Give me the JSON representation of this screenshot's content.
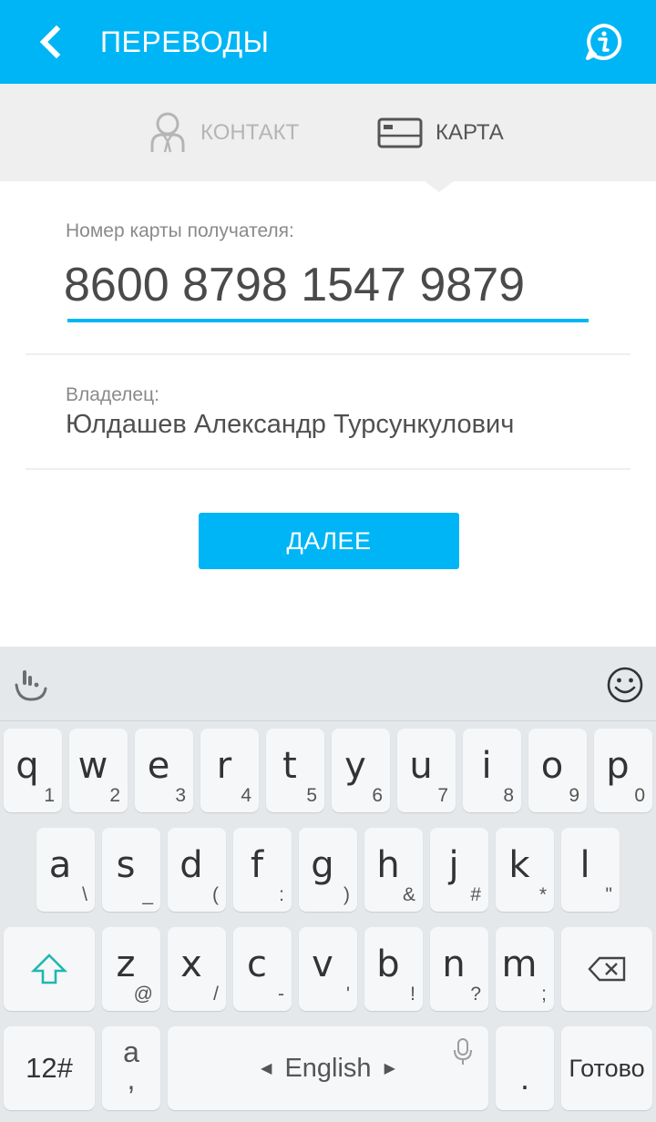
{
  "header": {
    "title": "ПЕРЕВОДЫ",
    "back_icon": "chevron-left-icon",
    "info_icon": "info-icon",
    "color": "#00b5f5"
  },
  "tabs": [
    {
      "label": "КОНТАКТ",
      "icon": "person-badge-icon",
      "active": false
    },
    {
      "label": "КАРТА",
      "icon": "credit-card-icon",
      "active": true
    }
  ],
  "form": {
    "card_label": "Номер карты получателя:",
    "card_value": "8600 8798 1547 9879",
    "owner_label": "Владелец:",
    "owner_value": "Юлдашев Александр Турсункулович",
    "next_label": "ДАЛЕЕ"
  },
  "keyboard": {
    "row1": [
      {
        "k": "q",
        "s": "1"
      },
      {
        "k": "w",
        "s": "2"
      },
      {
        "k": "e",
        "s": "3"
      },
      {
        "k": "r",
        "s": "4"
      },
      {
        "k": "t",
        "s": "5"
      },
      {
        "k": "y",
        "s": "6"
      },
      {
        "k": "u",
        "s": "7"
      },
      {
        "k": "i",
        "s": "8"
      },
      {
        "k": "o",
        "s": "9"
      },
      {
        "k": "p",
        "s": "0"
      }
    ],
    "row2": [
      {
        "k": "a",
        "s": "\\"
      },
      {
        "k": "s",
        "s": "_"
      },
      {
        "k": "d",
        "s": "("
      },
      {
        "k": "f",
        "s": ":"
      },
      {
        "k": "g",
        "s": ")"
      },
      {
        "k": "h",
        "s": "&"
      },
      {
        "k": "j",
        "s": "#"
      },
      {
        "k": "k",
        "s": "*"
      },
      {
        "k": "l",
        "s": "\""
      }
    ],
    "row3": [
      {
        "k": "z",
        "s": "@"
      },
      {
        "k": "x",
        "s": "/"
      },
      {
        "k": "c",
        "s": "-"
      },
      {
        "k": "v",
        "s": "'"
      },
      {
        "k": "b",
        "s": "!"
      },
      {
        "k": "n",
        "s": "?"
      },
      {
        "k": "m",
        "s": ";"
      }
    ],
    "symbols_label": "12#",
    "alt_key_top": "a",
    "alt_key_bottom": ",",
    "language": "English",
    "period": ".",
    "done_label": "Готово"
  }
}
